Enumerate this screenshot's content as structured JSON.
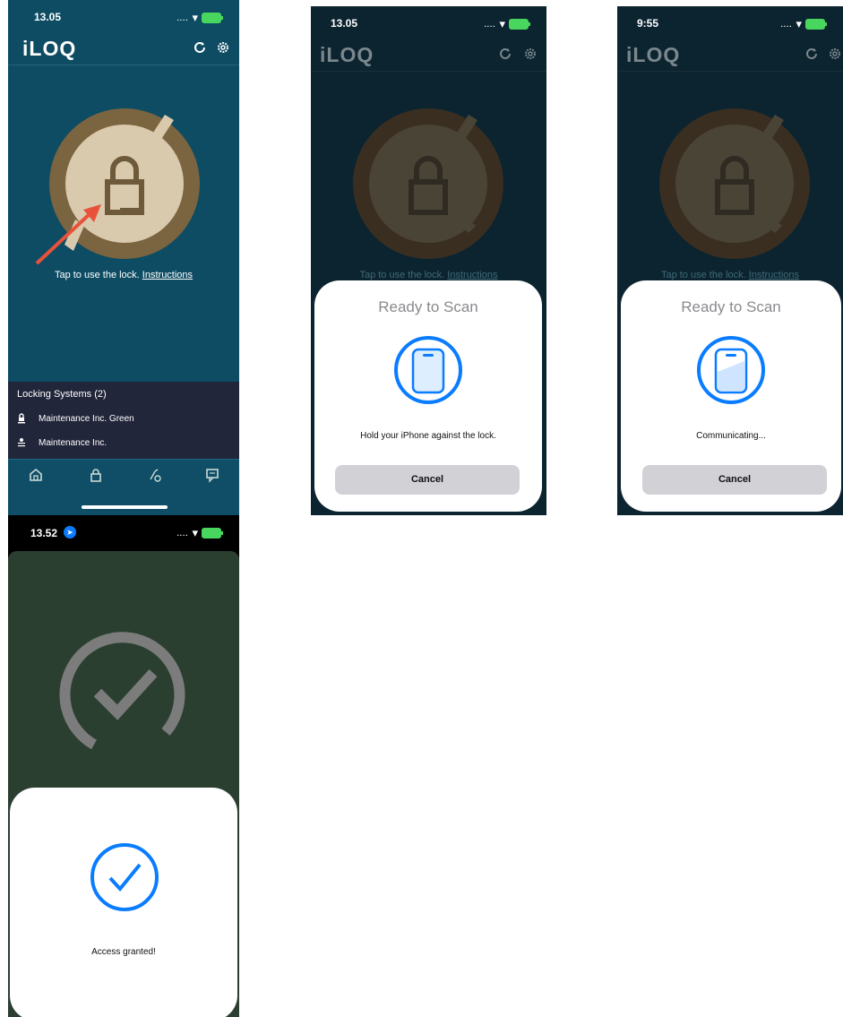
{
  "colors": {
    "teal": "#0d4c63",
    "dark_teal": "#0c2430",
    "green_bg": "#2b3f31",
    "accent_blue": "#0a7cff",
    "lock_ring": "#7b6440",
    "lock_face": "#d9c9ad",
    "arrow": "#e8523a"
  },
  "screen1": {
    "time": "13.05",
    "logo": "iLOQ",
    "hint": "Tap to use the lock.",
    "hint_link": "Instructions",
    "locking_systems_title": "Locking Systems (2)",
    "systems": [
      {
        "label": "Maintenance Inc. Green",
        "icon": "lock-system-icon"
      },
      {
        "label": "Maintenance Inc.",
        "icon": "lock-system-icon"
      }
    ],
    "tabs": [
      "home-icon",
      "lock-tab-icon",
      "key-tab-icon",
      "messages-icon"
    ]
  },
  "screen2": {
    "time": "13.05",
    "logo": "iLOQ",
    "hint": "Tap to use the lock.",
    "hint_link": "Instructions",
    "sheet_title": "Ready to Scan",
    "message": "Hold your iPhone against the lock.",
    "cancel": "Cancel"
  },
  "screen3": {
    "time": "9:55",
    "logo": "iLOQ",
    "hint": "Tap to use the lock.",
    "hint_link": "Instructions",
    "sheet_title": "Ready to Scan",
    "message": "Communicating...",
    "cancel": "Cancel"
  },
  "screen4": {
    "time": "13.52",
    "message": "Access granted!"
  }
}
